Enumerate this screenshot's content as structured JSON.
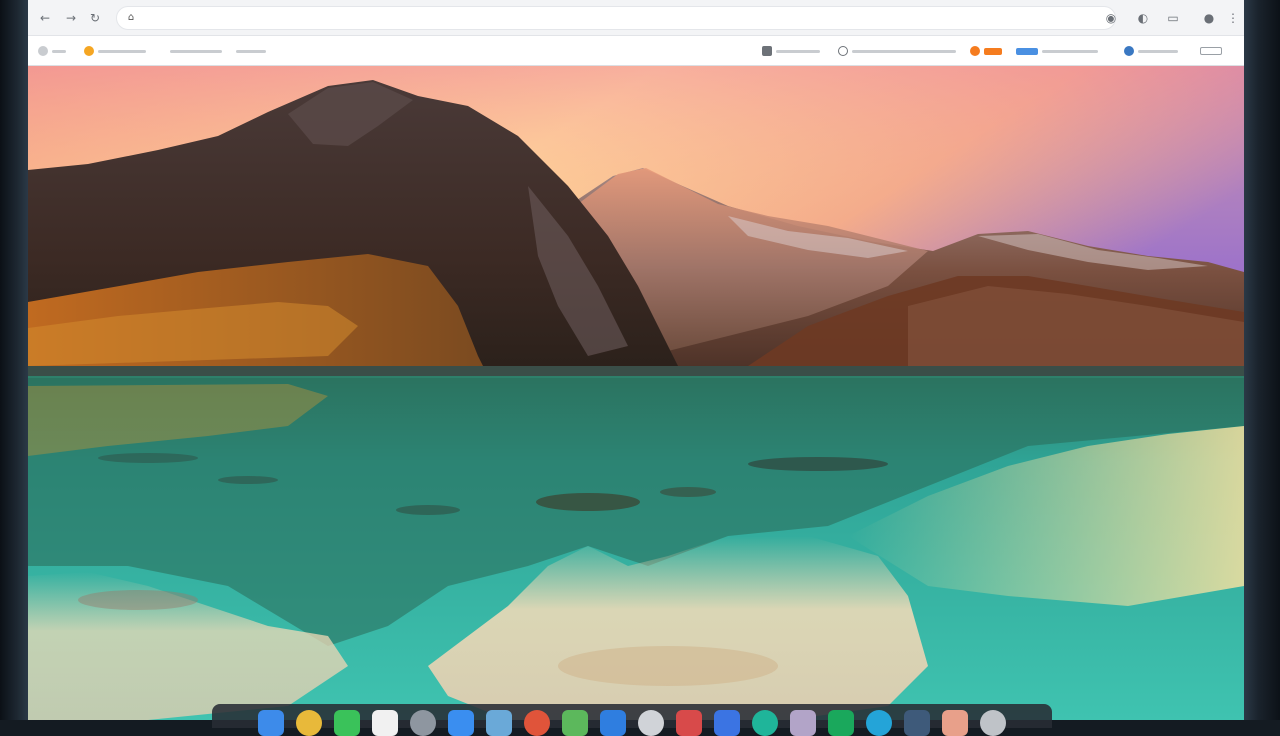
{
  "browser": {
    "nav": {
      "back_icon": "back-icon",
      "forward_icon": "forward-icon",
      "reload_icon": "reload-icon",
      "home_icon": "home-icon"
    },
    "omnibox": {
      "value": "",
      "placeholder": ""
    },
    "toolbar_icons": [
      "extension-icon",
      "shield-icon",
      "window-icon",
      "profile-icon",
      "menu-icon"
    ],
    "bookmarks": [
      {
        "name": "apps",
        "color": "#9aa0a6"
      },
      {
        "name": "orange-site",
        "color": "#f5a623"
      },
      {
        "name": "folder",
        "color": "#c1c5ca"
      },
      {
        "name": "folder-2",
        "color": "#c1c5ca"
      }
    ],
    "bookmarks_right": [
      {
        "name": "camera",
        "color": "#6d7278"
      },
      {
        "name": "globe",
        "color": "#6d7278"
      },
      {
        "name": "orange-2",
        "color": "#f57c1f"
      },
      {
        "name": "blue-tag",
        "color": "#4a90e2"
      },
      {
        "name": "person",
        "color": "#3a78c2"
      },
      {
        "name": "reading-list",
        "color": "#9aa0a6"
      }
    ]
  },
  "content": {
    "description_colors": {
      "sky_top": "#c27fb8",
      "sky_mid": "#f4b07a",
      "sky_low": "#ffd89a",
      "water": "#2fb3a3",
      "mountain_dark": "#3a2b28",
      "mountain_warm": "#8a4a2a"
    }
  },
  "dock": {
    "icons": [
      {
        "name": "finder-icon",
        "color": "#3d8bea"
      },
      {
        "name": "chrome-icon",
        "color": "#e8b93a"
      },
      {
        "name": "messages-icon",
        "color": "#3ac25a"
      },
      {
        "name": "notes-icon",
        "color": "#f1f1f1"
      },
      {
        "name": "settings-icon",
        "color": "#8e96a0"
      },
      {
        "name": "safari-icon",
        "color": "#3a8ef0"
      },
      {
        "name": "globe-icon",
        "color": "#6aa9d8"
      },
      {
        "name": "photos-icon",
        "color": "#e0543a"
      },
      {
        "name": "leaf-icon",
        "color": "#5cb85c"
      },
      {
        "name": "browser-icon",
        "color": "#2f7ee0"
      },
      {
        "name": "camera-icon",
        "color": "#d0d3d8"
      },
      {
        "name": "calendar-icon",
        "color": "#d84a4a"
      },
      {
        "name": "store-icon",
        "color": "#3b74e3"
      },
      {
        "name": "teal-icon",
        "color": "#1fb59a"
      },
      {
        "name": "gallery-icon",
        "color": "#b2a4c8"
      },
      {
        "name": "green-icon",
        "color": "#1aa85c"
      },
      {
        "name": "cyan-icon",
        "color": "#24a4d8"
      },
      {
        "name": "folder-icon",
        "color": "#3e5a7a"
      },
      {
        "name": "image-icon",
        "color": "#e8a08a"
      },
      {
        "name": "trash-icon",
        "color": "#bfc3c8"
      }
    ]
  }
}
